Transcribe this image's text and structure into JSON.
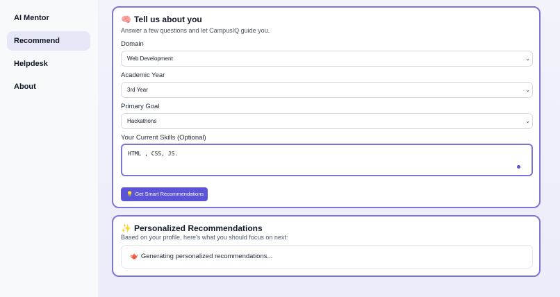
{
  "sidebar": {
    "items": [
      {
        "label": "AI Mentor",
        "active": false
      },
      {
        "label": "Recommend",
        "active": true
      },
      {
        "label": "Helpdesk",
        "active": false
      },
      {
        "label": "About",
        "active": false
      }
    ]
  },
  "profile_card": {
    "icon": "brain-icon",
    "title": "Tell us about you",
    "subtitle": "Answer a few questions and let CampusIQ guide you.",
    "domain": {
      "label": "Domain",
      "value": "Web Development"
    },
    "year": {
      "label": "Academic Year",
      "value": "3rd Year"
    },
    "goal": {
      "label": "Primary Goal",
      "value": "Hackathons"
    },
    "skills": {
      "label": "Your Current Skills (Optional)",
      "value": "HTML , CSS, JS."
    },
    "button_icon": "lightbulb-icon",
    "button_label": "Get Smart Recommendations"
  },
  "recommendations_card": {
    "icon": "sparkles-icon",
    "title": "Personalized Recommendations",
    "subtitle": "Based on your profile, here's what you should focus on next:",
    "status_icon": "teapot-icon",
    "status_text": "Generating personalized recommendations..."
  },
  "colors": {
    "accent": "#5b54d6",
    "card_border": "#7c75d8",
    "active_nav_bg": "#e6e8f8"
  }
}
